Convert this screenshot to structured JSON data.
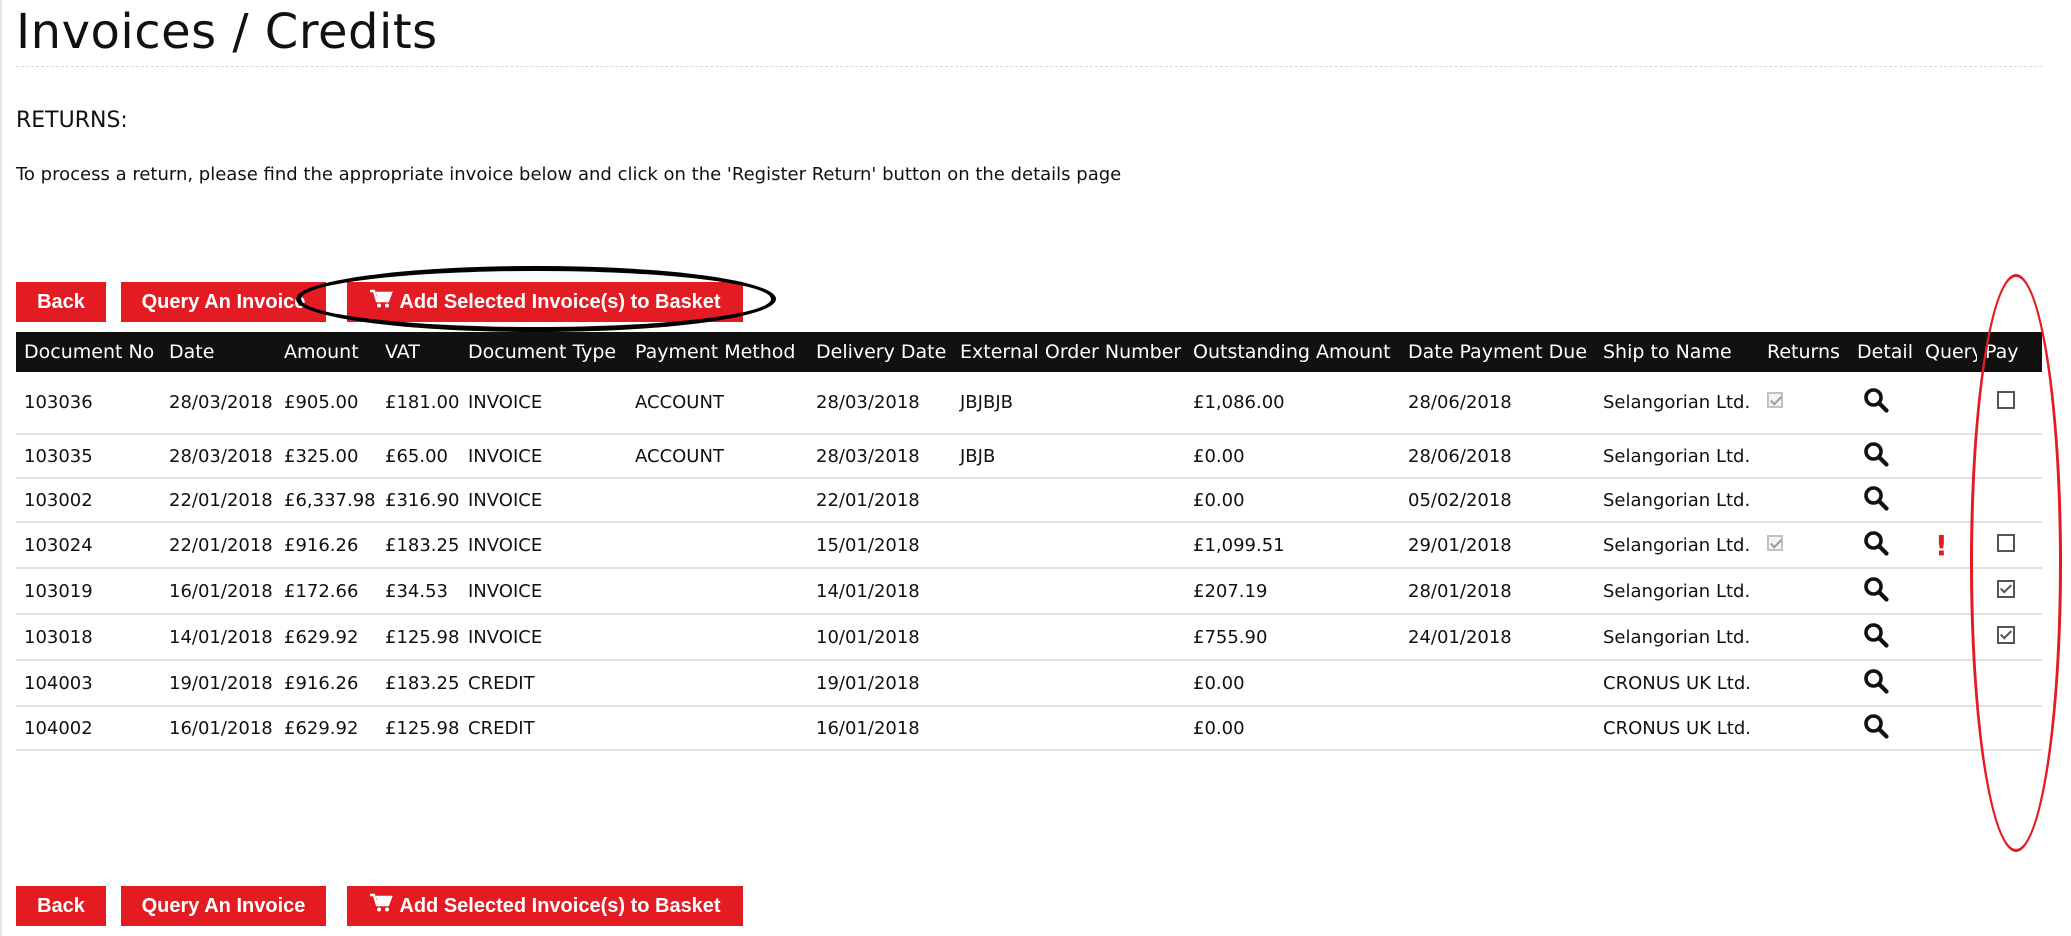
{
  "page": {
    "title": "Invoices / Credits",
    "returns_heading": "RETURNS:",
    "returns_text": "To process a return, please find the appropriate invoice below and click on the 'Register Return' button on the details page"
  },
  "buttons": {
    "back": "Back",
    "query": "Query An Invoice",
    "add_to_basket": "Add Selected Invoice(s) to Basket"
  },
  "colors": {
    "accent": "#e31b23",
    "header_bg": "#111111"
  },
  "icons": {
    "basket": "shopping-cart-icon",
    "detail": "magnifier-icon",
    "query_flag": "exclamation-icon"
  },
  "table": {
    "headers": [
      "Document No",
      "Date",
      "Amount",
      "VAT",
      "Document Type",
      "Payment Method",
      "Delivery Date",
      "External Order Number",
      "Outstanding Amount",
      "Date Payment Due",
      "Ship to Name",
      "Returns",
      "Detail",
      "Query",
      "Pay"
    ],
    "rows": [
      {
        "doc": "103036",
        "date": "28/03/2018",
        "amount": "£905.00",
        "vat": "£181.00",
        "type": "INVOICE",
        "method": "ACCOUNT",
        "delivery": "28/03/2018",
        "ext": "JBJBJB",
        "outstanding": "£1,086.00",
        "due": "28/06/2018",
        "ship": "Selangorian Ltd.",
        "returns": true,
        "query": false,
        "pay": "unchecked"
      },
      {
        "doc": "103035",
        "date": "28/03/2018",
        "amount": "£325.00",
        "vat": "£65.00",
        "type": "INVOICE",
        "method": "ACCOUNT",
        "delivery": "28/03/2018",
        "ext": "JBJB",
        "outstanding": "£0.00",
        "due": "28/06/2018",
        "ship": "Selangorian Ltd.",
        "returns": false,
        "query": false,
        "pay": "none"
      },
      {
        "doc": "103002",
        "date": "22/01/2018",
        "amount": "£6,337.98",
        "vat": "£316.90",
        "type": "INVOICE",
        "method": "",
        "delivery": "22/01/2018",
        "ext": "",
        "outstanding": "£0.00",
        "due": "05/02/2018",
        "ship": "Selangorian Ltd.",
        "returns": false,
        "query": false,
        "pay": "none"
      },
      {
        "doc": "103024",
        "date": "22/01/2018",
        "amount": "£916.26",
        "vat": "£183.25",
        "type": "INVOICE",
        "method": "",
        "delivery": "15/01/2018",
        "ext": "",
        "outstanding": "£1,099.51",
        "due": "29/01/2018",
        "ship": "Selangorian Ltd.",
        "returns": true,
        "query": true,
        "pay": "unchecked"
      },
      {
        "doc": "103019",
        "date": "16/01/2018",
        "amount": "£172.66",
        "vat": "£34.53",
        "type": "INVOICE",
        "method": "",
        "delivery": "14/01/2018",
        "ext": "",
        "outstanding": "£207.19",
        "due": "28/01/2018",
        "ship": "Selangorian Ltd.",
        "returns": false,
        "query": false,
        "pay": "checked"
      },
      {
        "doc": "103018",
        "date": "14/01/2018",
        "amount": "£629.92",
        "vat": "£125.98",
        "type": "INVOICE",
        "method": "",
        "delivery": "10/01/2018",
        "ext": "",
        "outstanding": "£755.90",
        "due": "24/01/2018",
        "ship": "Selangorian Ltd.",
        "returns": false,
        "query": false,
        "pay": "checked"
      },
      {
        "doc": "104003",
        "date": "19/01/2018",
        "amount": "£916.26",
        "vat": "£183.25",
        "type": "CREDIT",
        "method": "",
        "delivery": "19/01/2018",
        "ext": "",
        "outstanding": "£0.00",
        "due": "",
        "ship": "CRONUS UK Ltd.",
        "returns": false,
        "query": false,
        "pay": "none"
      },
      {
        "doc": "104002",
        "date": "16/01/2018",
        "amount": "£629.92",
        "vat": "£125.98",
        "type": "CREDIT",
        "method": "",
        "delivery": "16/01/2018",
        "ext": "",
        "outstanding": "£0.00",
        "due": "",
        "ship": "CRONUS UK Ltd.",
        "returns": false,
        "query": false,
        "pay": "none"
      }
    ]
  }
}
